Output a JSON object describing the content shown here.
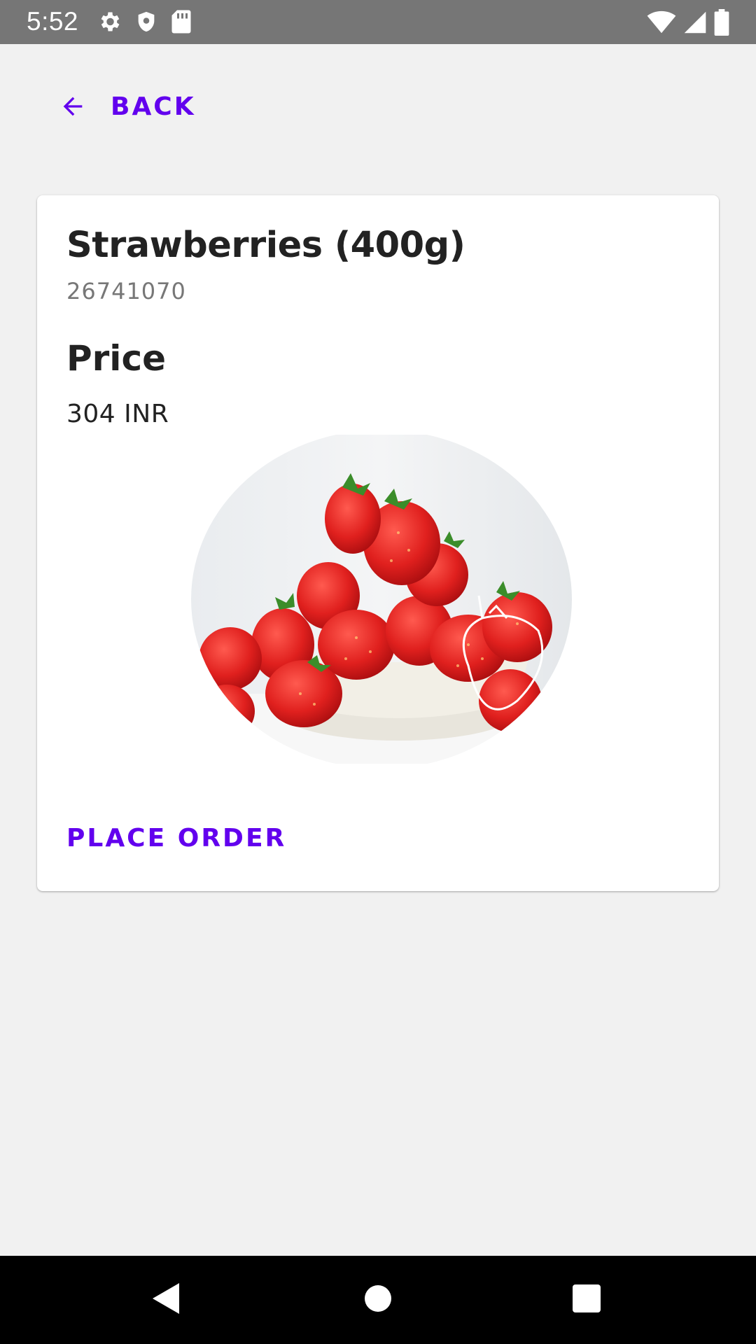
{
  "status_bar": {
    "time": "5:52",
    "left_icons": [
      "settings-icon",
      "shield-icon",
      "sd-card-icon"
    ],
    "right_icons": [
      "wifi-icon",
      "cell-signal-icon",
      "battery-icon"
    ]
  },
  "header": {
    "back_icon": "arrow-left-icon",
    "back_label": "BACK"
  },
  "product": {
    "title": "Strawberries (400g)",
    "code": "26741070",
    "price_heading": "Price",
    "price_value": "304 INR",
    "image": "strawberry-bowl-image"
  },
  "actions": {
    "place_order_label": "PLACE ORDER"
  },
  "nav_bar": {
    "back_icon": "nav-back-icon",
    "home_icon": "nav-home-icon",
    "recents_icon": "nav-recents-icon"
  },
  "colors": {
    "accent": "#6200ee",
    "status_bar": "#767676",
    "background": "#f1f1f1",
    "card": "#ffffff"
  }
}
